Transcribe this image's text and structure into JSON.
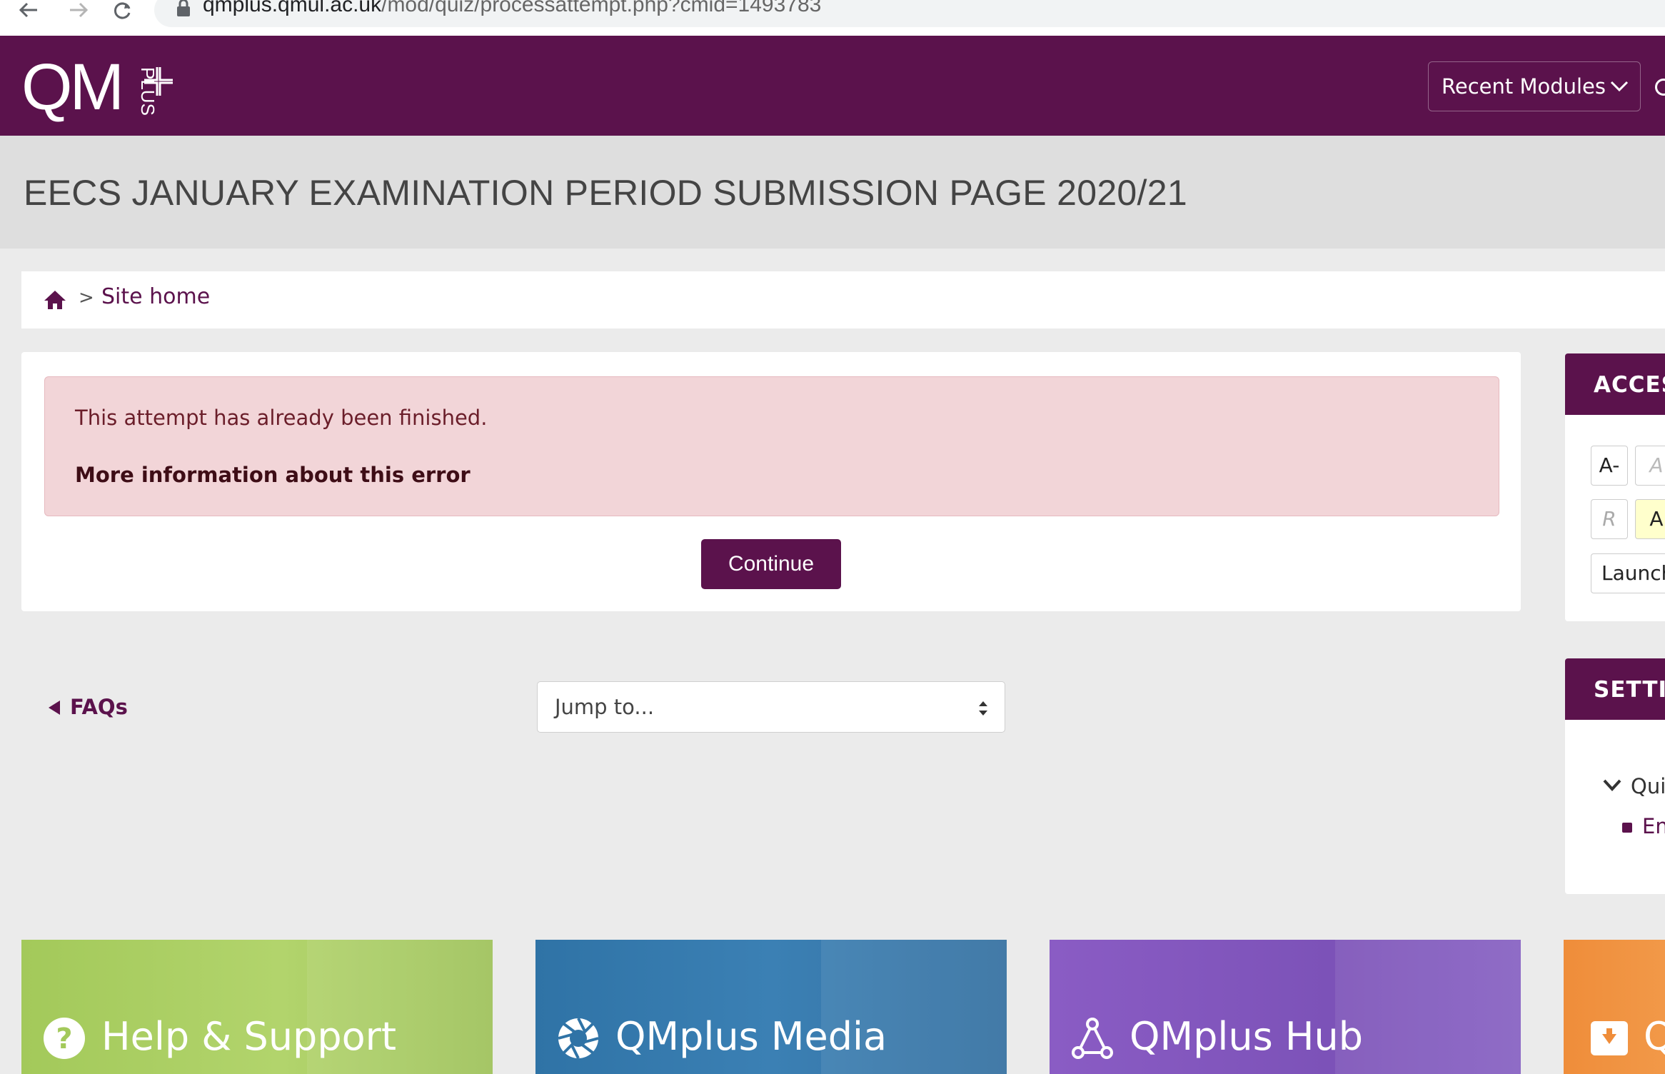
{
  "browser": {
    "url_host": "qmplus.qmul.ac.uk",
    "url_path": "/mod/quiz/processattempt.php?cmid=1493783"
  },
  "header": {
    "logo_text": "QM",
    "logo_subtext": "PLUS",
    "recent_modules_label": "Recent Modules",
    "brand_color": "#5b124c"
  },
  "page": {
    "title": "EECS JANUARY EXAMINATION PERIOD SUBMISSION PAGE 2020/21"
  },
  "breadcrumb": {
    "separator": ">",
    "items": [
      {
        "label": "Site home"
      }
    ]
  },
  "notice": {
    "message": "This attempt has already been finished.",
    "more_info_link": "More information about this error",
    "continue_label": "Continue"
  },
  "activity_nav": {
    "prev_label": "FAQs",
    "jump_placeholder": "Jump to..."
  },
  "blocks": {
    "accessibility": {
      "title": "ACCES",
      "buttons": [
        "A-",
        "A",
        "R",
        "A"
      ],
      "launch_label": "Launch"
    },
    "settings": {
      "title": "SETTI",
      "tree_item": "Qui",
      "tree_child": "En"
    }
  },
  "tiles": [
    {
      "label": "Help & Support",
      "icon": "question-circle-icon",
      "color": "#a3c95a"
    },
    {
      "label": "QMplus Media",
      "icon": "aperture-icon",
      "color": "#2f73a6"
    },
    {
      "label": "QMplus Hub",
      "icon": "network-icon",
      "color": "#8a5cc4"
    },
    {
      "label": "Q",
      "icon": "archive-icon",
      "color": "#ef8d3a"
    }
  ]
}
